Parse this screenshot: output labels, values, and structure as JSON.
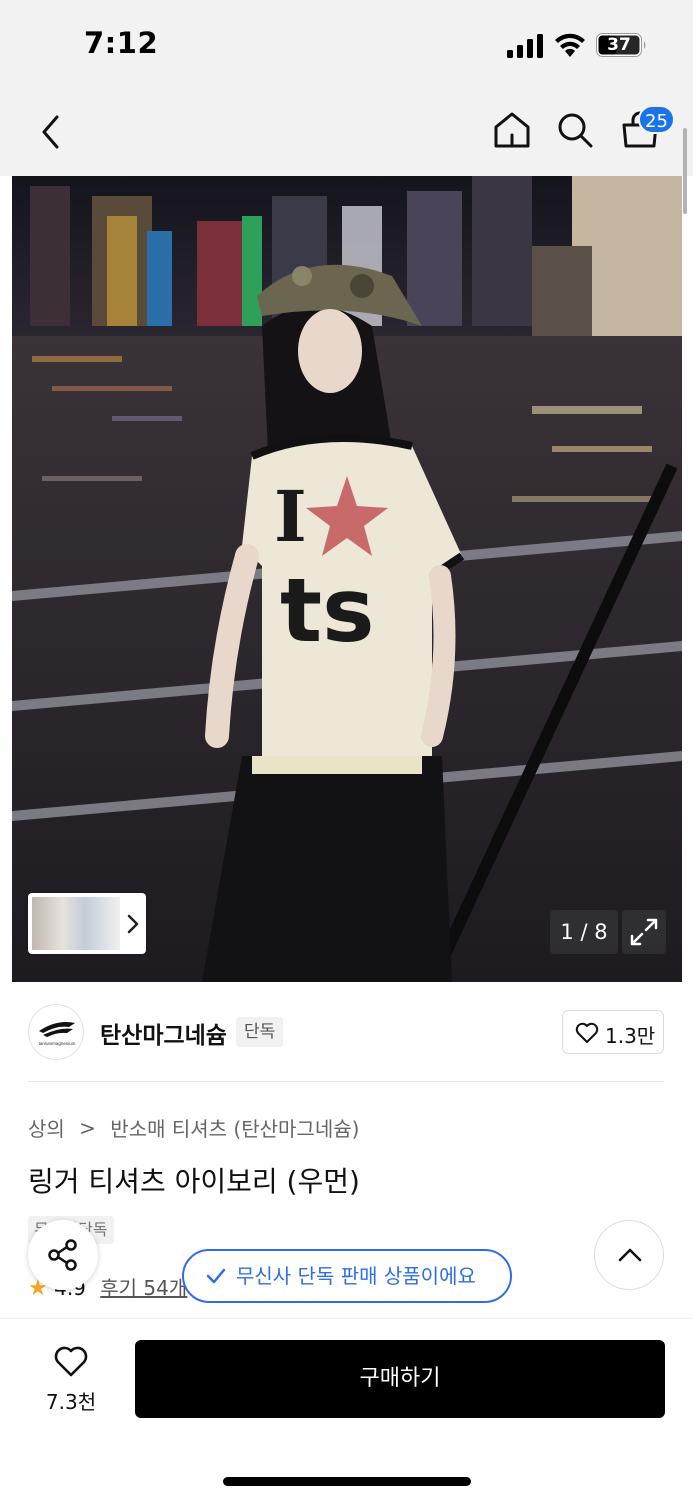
{
  "status_bar": {
    "time": "7:12",
    "battery": "37"
  },
  "nav": {
    "cart_count": "25",
    "icons": [
      "back-icon",
      "home-icon",
      "search-icon",
      "cart-icon"
    ]
  },
  "hero": {
    "image_description": "Woman in camo cap and ringer tee at night by a harbor railing",
    "shirt_print": "I ts",
    "counter": "1 / 8",
    "icons": [
      "chevron-right-icon",
      "expand-icon"
    ]
  },
  "brand": {
    "name": "탄산마그네슘",
    "tag": "단독",
    "like_count": "1.3만",
    "logo_text": "tansanmagnesium"
  },
  "product": {
    "breadcrumb": [
      "상의",
      "반소매 티셔츠 (탄산마그네슘)"
    ],
    "title": "링거 티셔츠 아이보리 (우먼)",
    "tag": "무신사단독",
    "rating": "4.9",
    "review_text": "후기 54개"
  },
  "toast": {
    "text": "무신사 단독 판매 상품이에요"
  },
  "bottom": {
    "wish_count": "7.3천",
    "buy_label": "구매하기"
  },
  "colors": {
    "accent": "#2f6de8",
    "badge": "#1a73e8",
    "star": "#f5a623",
    "buy": "#000000"
  }
}
